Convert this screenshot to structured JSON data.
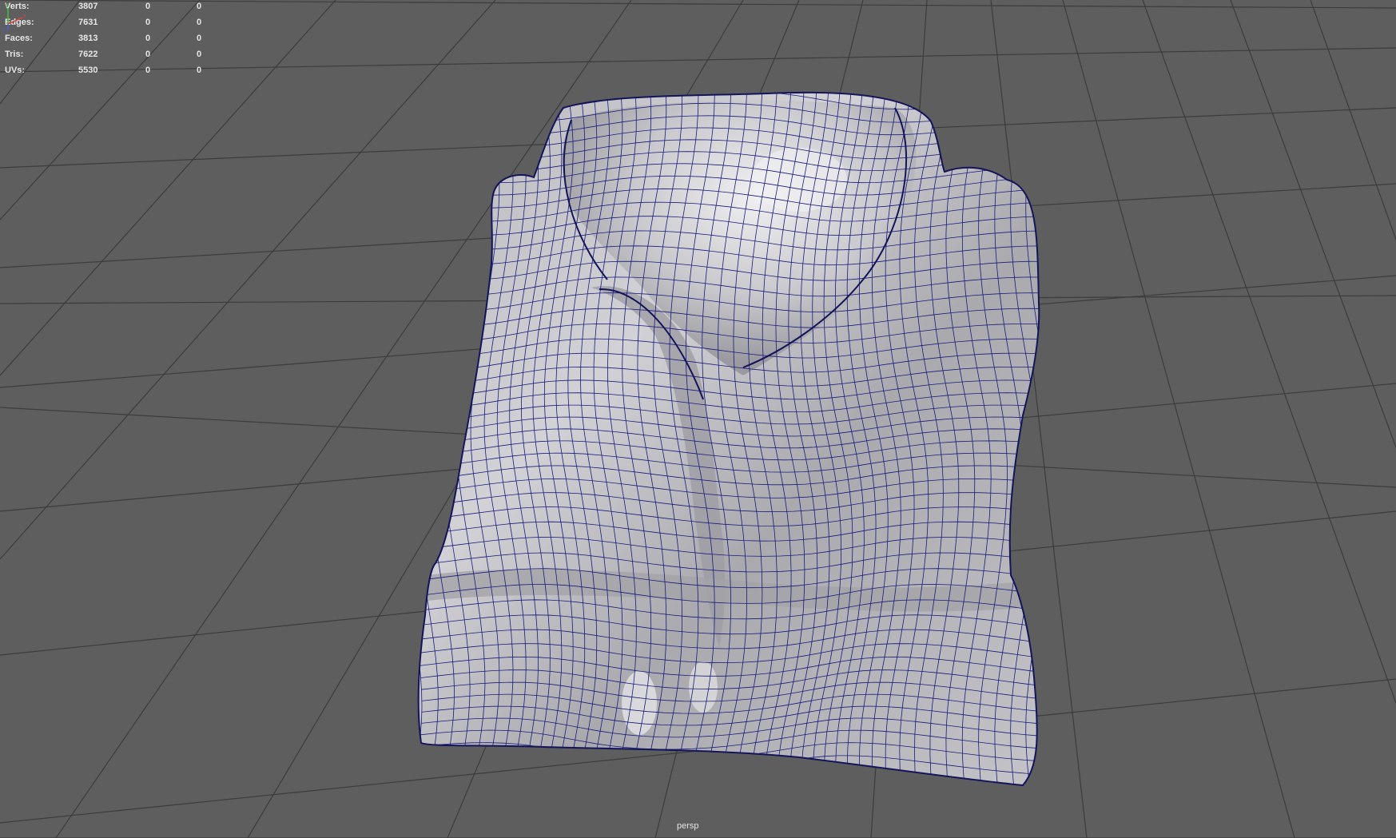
{
  "hud": {
    "rows": [
      {
        "label": "Verts:",
        "total": "3807",
        "selected": "0",
        "extra": "0"
      },
      {
        "label": "Edges:",
        "total": "7631",
        "selected": "0",
        "extra": "0"
      },
      {
        "label": "Faces:",
        "total": "3813",
        "selected": "0",
        "extra": "0"
      },
      {
        "label": "Tris:",
        "total": "7622",
        "selected": "0",
        "extra": "0"
      },
      {
        "label": "UVs:",
        "total": "5530",
        "selected": "0",
        "extra": "0"
      }
    ]
  },
  "viewport": {
    "camera_name": "persp",
    "background_color": "#5e5e5e",
    "grid_color": "#3a3a3a",
    "wire_color": "#1a1a7a"
  },
  "axis_gizmo": {
    "x_label": "x",
    "y_label": "y",
    "z_label": "z",
    "x_color": "#e04040",
    "y_color": "#40c040",
    "z_color": "#4060e0"
  }
}
